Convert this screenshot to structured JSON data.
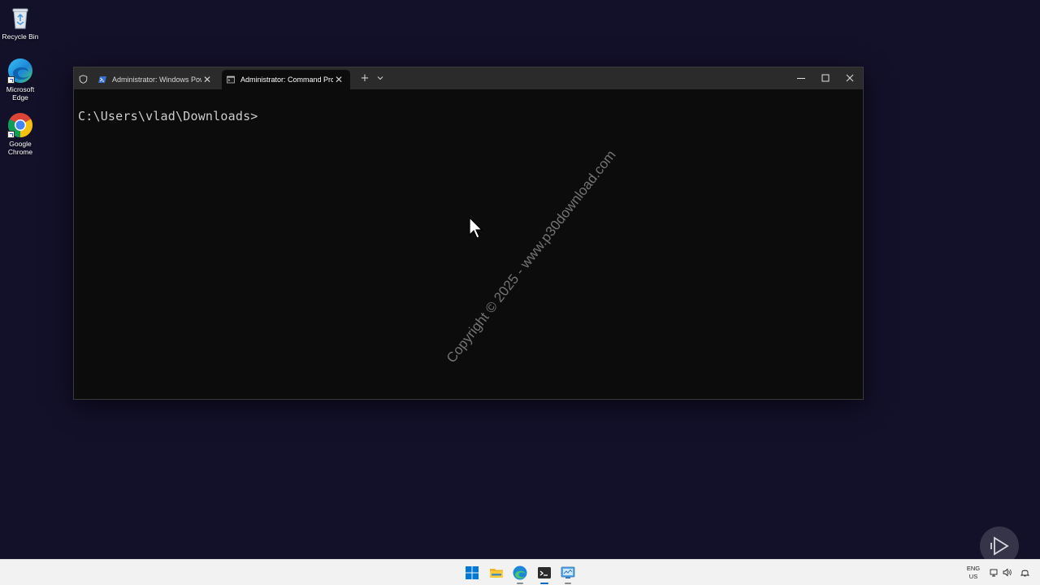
{
  "desktop": {
    "icons": [
      {
        "label": "Recycle Bin",
        "icon": "recycle-bin-icon"
      },
      {
        "label": "Microsoft Edge",
        "icon": "edge-icon"
      },
      {
        "label": "Google Chrome",
        "icon": "chrome-icon"
      }
    ]
  },
  "terminal": {
    "tabs": [
      {
        "label": "Administrator: Windows PowerShell",
        "icon": "powershell-icon",
        "active": false
      },
      {
        "label": "Administrator: Command Prompt",
        "icon": "cmd-icon",
        "active": true
      }
    ],
    "prompt": "C:\\Users\\vlad\\Downloads>",
    "watermark": "Copyright © 2025 - www.p30download.com"
  },
  "taskbar": {
    "items": [
      "start-icon",
      "file-explorer-icon",
      "edge-icon",
      "terminal-icon",
      "control-panel-icon"
    ],
    "language": {
      "line1": "ENG",
      "line2": "US"
    }
  },
  "colors": {
    "desktop_bg": "#13102a",
    "terminal_bg": "#0c0c0c",
    "titlebar_bg": "#2b2b2b",
    "taskbar_bg": "#f2f2f2",
    "accent": "#0067c0"
  }
}
